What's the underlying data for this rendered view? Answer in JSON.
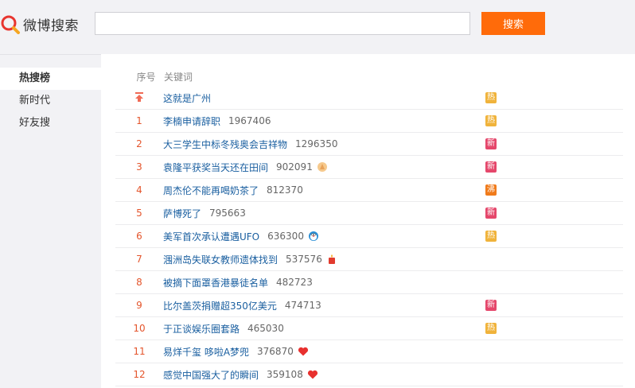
{
  "header": {
    "logo_text": "微博搜索",
    "search_value": "",
    "search_button": "搜索"
  },
  "sidebar": {
    "items": [
      {
        "label": "热搜榜",
        "active": true
      },
      {
        "label": "新时代",
        "active": false
      },
      {
        "label": "好友搜",
        "active": false
      }
    ]
  },
  "table": {
    "headers": {
      "rank": "序号",
      "keyword": "关键词"
    },
    "rows": [
      {
        "rank": "",
        "pinned": true,
        "keyword": "这就是广州",
        "count": "",
        "emoji": "",
        "badge": "热",
        "badge_type": "hot"
      },
      {
        "rank": "1",
        "keyword": "李楠申请辞职",
        "count": "1967406",
        "emoji": "",
        "badge": "热",
        "badge_type": "hot"
      },
      {
        "rank": "2",
        "keyword": "大三学生中标冬残奥会吉祥物",
        "count": "1296350",
        "emoji": "",
        "badge": "新",
        "badge_type": "new"
      },
      {
        "rank": "3",
        "keyword": "袁隆平获奖当天还在田间",
        "count": "902091",
        "emoji": "praying-hands-icon",
        "badge": "新",
        "badge_type": "new"
      },
      {
        "rank": "4",
        "keyword": "周杰伦不能再喝奶茶了",
        "count": "812370",
        "emoji": "",
        "badge": "沸",
        "badge_type": "boil"
      },
      {
        "rank": "5",
        "keyword": "萨博死了",
        "count": "795663",
        "emoji": "",
        "badge": "新",
        "badge_type": "new"
      },
      {
        "rank": "6",
        "keyword": "美军首次承认遭遇UFO",
        "count": "636300",
        "emoji": "doraemon-icon",
        "badge": "热",
        "badge_type": "hot"
      },
      {
        "rank": "7",
        "keyword": "涠洲岛失联女教师遗体找到",
        "count": "537576",
        "emoji": "candle-icon",
        "badge": "",
        "badge_type": ""
      },
      {
        "rank": "8",
        "keyword": "被摘下面罩香港暴徒名单",
        "count": "482723",
        "emoji": "",
        "badge": "",
        "badge_type": ""
      },
      {
        "rank": "9",
        "keyword": "比尔盖茨捐赠超350亿美元",
        "count": "474713",
        "emoji": "",
        "badge": "新",
        "badge_type": "new"
      },
      {
        "rank": "10",
        "keyword": "于正谈娱乐圈套路",
        "count": "465030",
        "emoji": "",
        "badge": "热",
        "badge_type": "hot"
      },
      {
        "rank": "11",
        "keyword": "易烊千玺 哆啦A梦兜",
        "count": "376870",
        "emoji": "heart-icon",
        "badge": "",
        "badge_type": ""
      },
      {
        "rank": "12",
        "keyword": "感觉中国强大了的瞬间",
        "count": "359108",
        "emoji": "heart-icon",
        "badge": "",
        "badge_type": ""
      }
    ]
  },
  "colors": {
    "accent": "#ff6b0a",
    "link": "#1a5fa0",
    "rank": "#e4552c",
    "hot": "#f0b33b",
    "new": "#e5476b",
    "boil": "#f07b1b"
  }
}
